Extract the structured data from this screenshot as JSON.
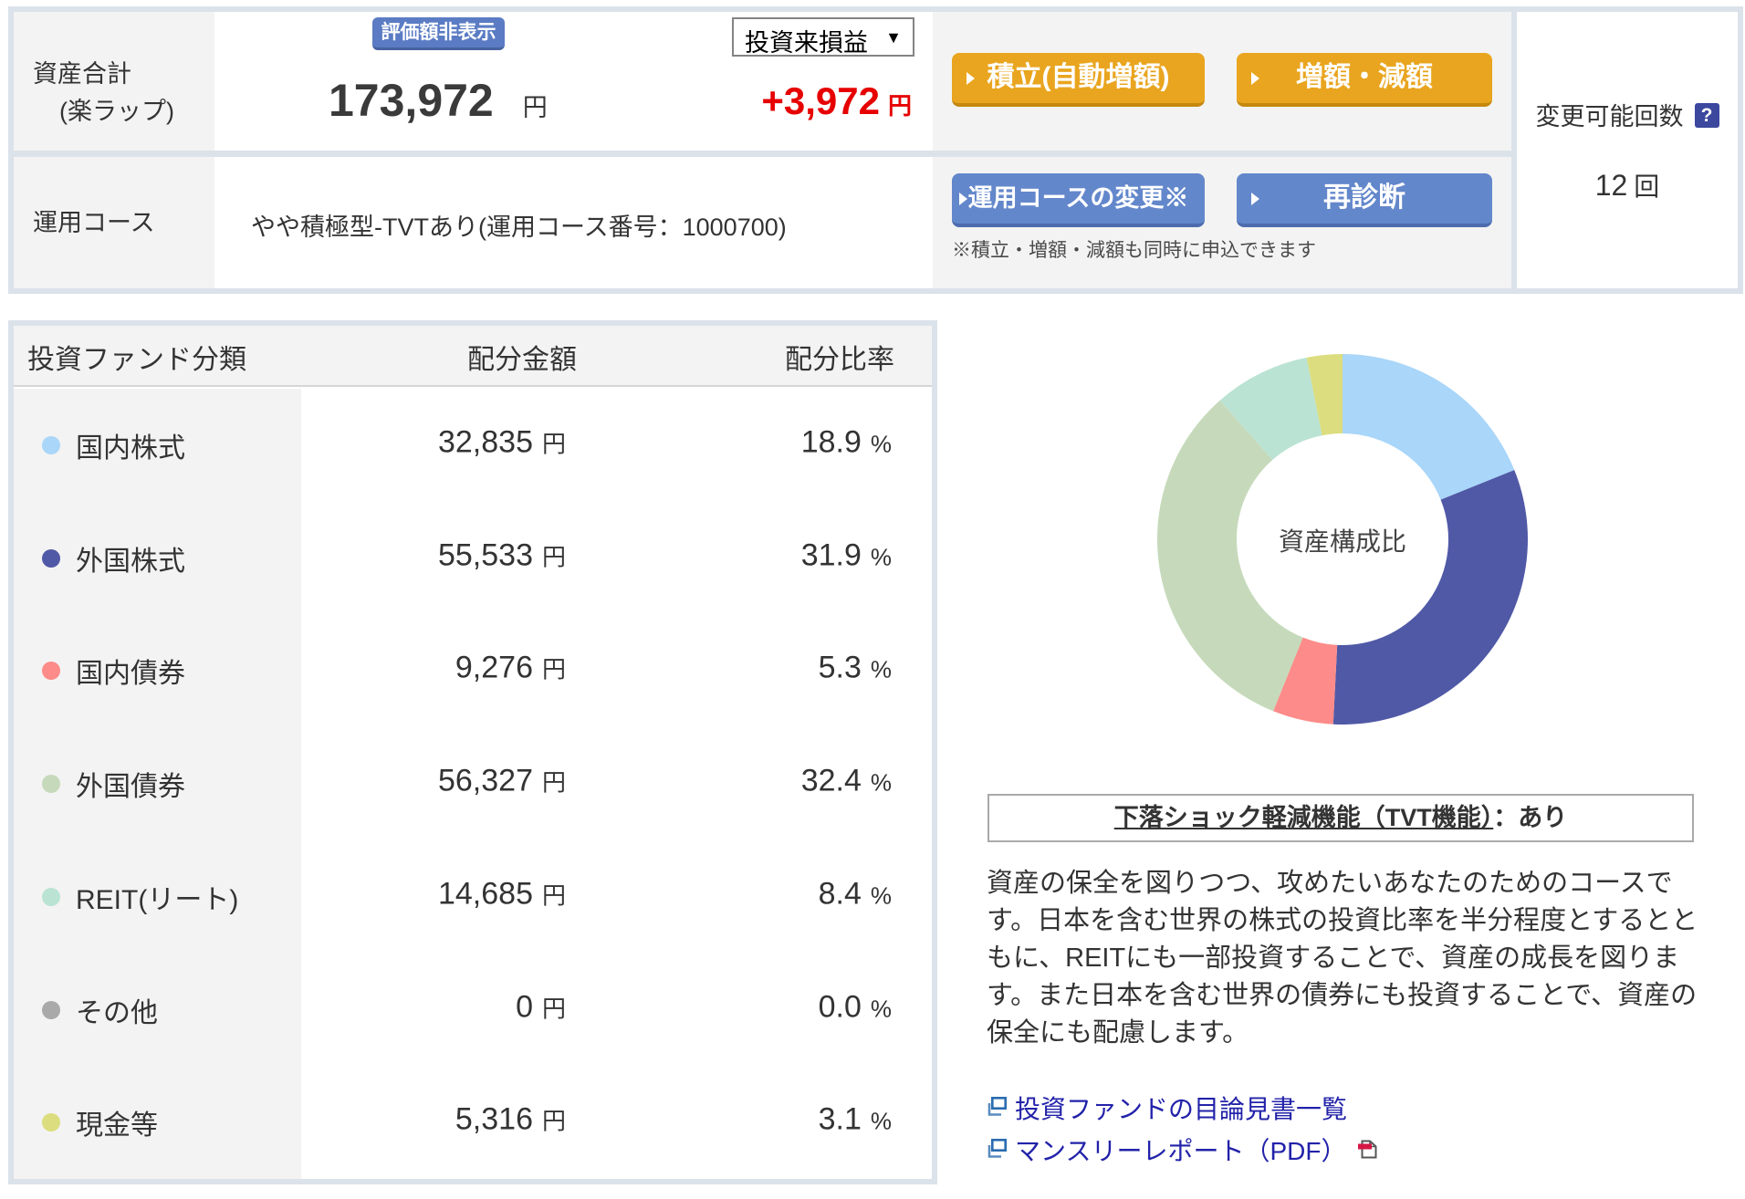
{
  "summary": {
    "total_label_line1": "資産合計",
    "total_label_line2": "(楽ラップ)",
    "hide_value_button": "評価額非表示",
    "total_amount": "173,972",
    "total_amount_suffix": "円",
    "profit_select_value": "投資来損益",
    "profit_amount": "+3,972",
    "profit_amount_suffix": "円",
    "course_row_label": "運用コース",
    "course_name": "やや積極型-TVTあり(運用コース番号：1000700)",
    "buttons": {
      "reserve": "積立(自動増額)",
      "increase_decrease": "増額・減額",
      "course_change": "運用コースの変更※",
      "rediagnosis": "再診断"
    },
    "note": "※積立・増額・減額も同時に申込できます",
    "sidebar": {
      "label": "変更可能回数",
      "help": "?",
      "count": "12",
      "count_suffix": "回"
    }
  },
  "table": {
    "header_category": "投資ファンド分類",
    "header_amount": "配分金額",
    "header_ratio": "配分比率",
    "amount_suffix": "円",
    "ratio_suffix": "%",
    "rows": [
      {
        "label": "国内株式",
        "amount": "32,835",
        "ratio": "18.9",
        "color": "#a9d6f9"
      },
      {
        "label": "外国株式",
        "amount": "55,533",
        "ratio": "31.9",
        "color": "#5059a6"
      },
      {
        "label": "国内債券",
        "amount": "9,276",
        "ratio": "5.3",
        "color": "#fd8b89"
      },
      {
        "label": "外国債券",
        "amount": "56,327",
        "ratio": "32.4",
        "color": "#c6dabb"
      },
      {
        "label": "REIT(リート)",
        "amount": "14,685",
        "ratio": "8.4",
        "color": "#bae3d3"
      },
      {
        "label": "その他",
        "amount": "0",
        "ratio": "0.0",
        "color": "#a9a9a9"
      },
      {
        "label": "現金等",
        "amount": "5,316",
        "ratio": "3.1",
        "color": "#dcdd7e"
      }
    ]
  },
  "chart_data": {
    "type": "pie",
    "subtype": "donut",
    "title": "資産構成比",
    "categories": [
      "国内株式",
      "外国株式",
      "国内債券",
      "外国債券",
      "REIT(リート)",
      "その他",
      "現金等"
    ],
    "values": [
      18.9,
      31.9,
      5.3,
      32.4,
      8.4,
      0.0,
      3.1
    ],
    "amounts_yen": [
      32835,
      55533,
      9276,
      56327,
      14685,
      0,
      5316
    ],
    "colors": [
      "#a9d6f9",
      "#5059a6",
      "#fd8b89",
      "#c6dabb",
      "#bae3d3",
      "#a9a9a9",
      "#dcdd7e"
    ],
    "center_label": "資産構成比",
    "start_angle_deg": 0,
    "direction": "clockwise",
    "inner_radius_ratio": 0.57,
    "legend_position": "none"
  },
  "tvt": {
    "title_underlined": "下落ショック軽減機能（TVT機能）",
    "title_suffix": "：あり"
  },
  "description": "資産の保全を図りつつ、攻めたいあなたのためのコースです。日本を含む世界の株式の投資比率を半分程度とするとともに、REITにも一部投資することで、資産の成長を図ります。また日本を含む世界の債券にも投資することで、資産の保全にも配慮します。",
  "links": {
    "prospectus": "投資ファンドの目論見書一覧",
    "monthly_report": "マンスリーレポート（PDF）"
  },
  "icons": {
    "select_arrow": "▼",
    "help": "?",
    "button_arrow": "triangle-right",
    "link_icon": "external-link-window",
    "pdf_icon": "pdf-document"
  },
  "colors": {
    "panel_border": "#dbe2ea",
    "cell_gray": "#f3f3f3",
    "accent_orange": "#e9a51f",
    "accent_blue": "#6387cb",
    "badge_blue": "#5b7cc4",
    "profit_red": "#e60000",
    "link_blue": "#2222aa"
  }
}
